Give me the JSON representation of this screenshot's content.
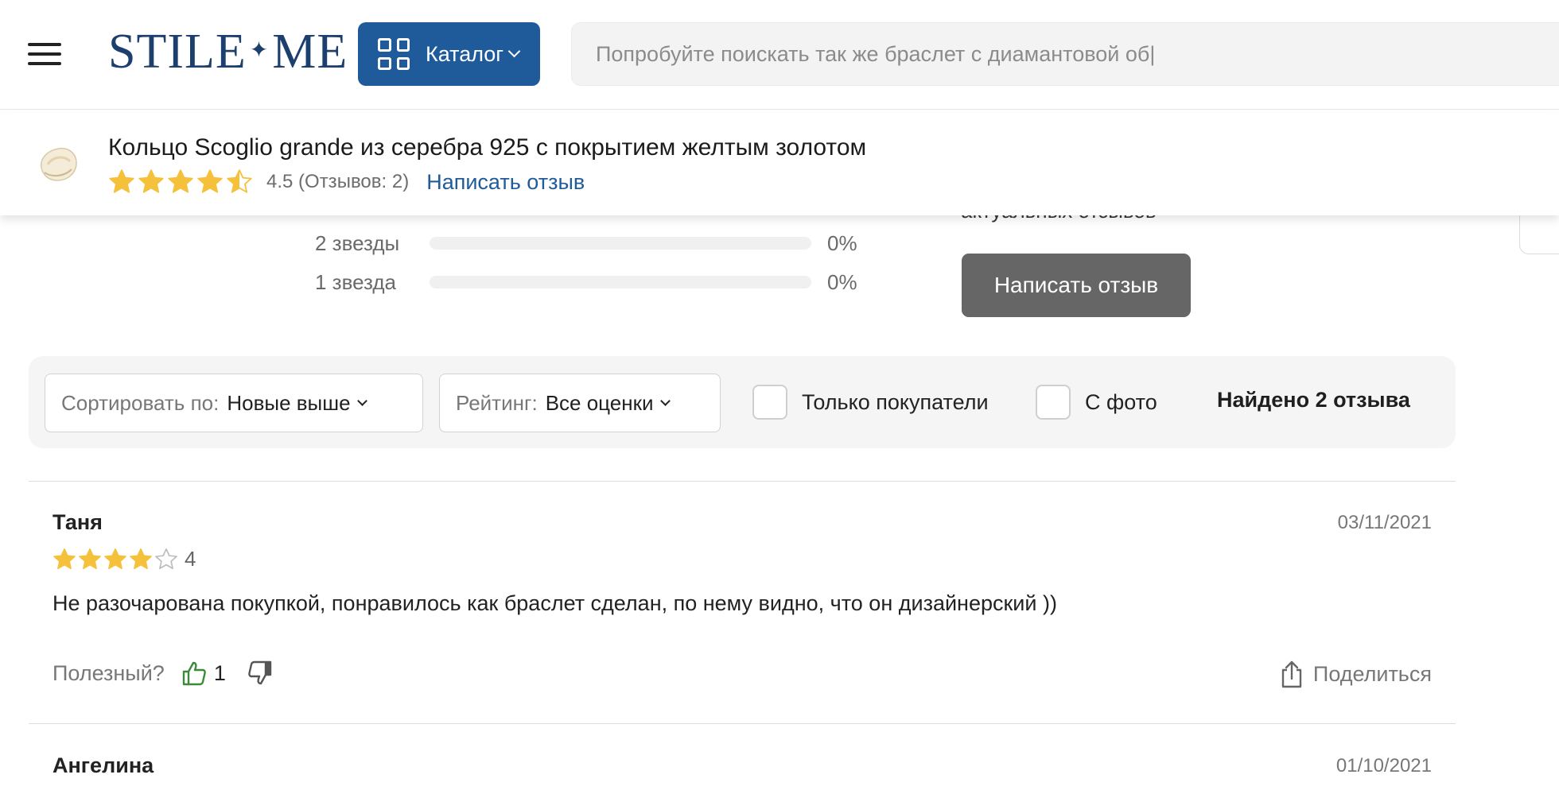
{
  "header": {
    "logo_left": "STILE",
    "logo_dot": "✦",
    "logo_right": "ME",
    "catalog_label": "Каталог",
    "search_placeholder": "Попробуйте поискать так же браслет с диамантовой об|"
  },
  "product": {
    "title": "Кольцо Scoglio grande из серебра 925 с покрытием желтым золотом",
    "rating": 4.5,
    "rating_meta": "4.5 (Отзывов: 2)",
    "write_review_link": "Написать отзыв"
  },
  "summary": {
    "hidden_text": "актуальных отзывов",
    "distribution": [
      {
        "label": "2 звезды",
        "pct": "0%",
        "value": 0
      },
      {
        "label": "1 звезда",
        "pct": "0%",
        "value": 0
      }
    ],
    "write_review_button": "Написать отзыв"
  },
  "filters": {
    "sort_key": "Сортировать по:",
    "sort_value": "Новые выше",
    "rating_key": "Рейтинг:",
    "rating_value": "Все оценки",
    "buyers_only": "Только покупатели",
    "with_photo": "С фото",
    "found": "Найдено 2 отзыва"
  },
  "reviews": [
    {
      "name": "Таня",
      "date": "03/11/2021",
      "stars": 4,
      "stars_label": "4",
      "text": "Не разочарована покупкой, понравилось как браслет сделан, по нему видно, что он дизайнерский ))",
      "helpful_label": "Полезный?",
      "likes": "1",
      "share_label": "Поделиться"
    },
    {
      "name": "Ангелина",
      "date": "01/10/2021"
    }
  ],
  "colors": {
    "brand": "#1f5a9a",
    "star": "#f5c13b",
    "star_empty": "#bbbbbb",
    "like": "#3a8a3a"
  }
}
